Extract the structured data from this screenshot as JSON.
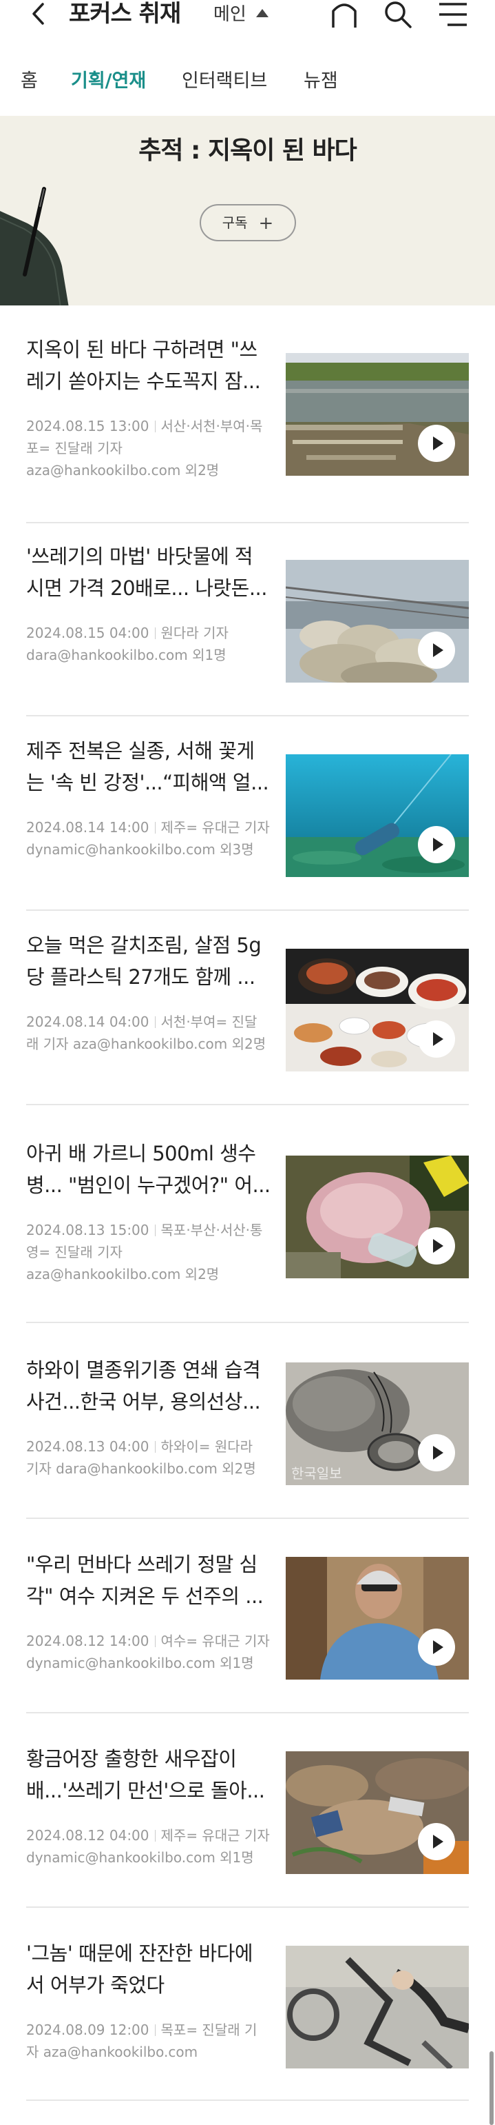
{
  "header": {
    "back_icon": "chevron-left-icon",
    "section_title": "포커스 취재",
    "sub_select": "메인",
    "icons": [
      "home-icon",
      "search-icon",
      "menu-icon"
    ]
  },
  "tabs": [
    {
      "label": "홈",
      "active": false
    },
    {
      "label": "기획/연재",
      "active": true
    },
    {
      "label": "인터랙티브",
      "active": false
    },
    {
      "label": "뉴잼",
      "active": false
    }
  ],
  "colors": {
    "accent": "#1a8f8a",
    "banner_bg": "#f2f0e7",
    "meta_text": "#999999"
  },
  "banner": {
    "title": "추적 : 지옥이 된 바다",
    "subscribe_label": "구독",
    "subscribe_icon": "+"
  },
  "articles": [
    {
      "title_lines": [
        "지옥이 된 바다 구하려면 \"쓰",
        "레기 쏟아지는 수도꼭지 잠..."
      ],
      "date": "2024.08.15 13:00",
      "byline_lines": [
        "서산·서천·부여·목",
        "포= 진달래 기자",
        "aza@hankookilbo.com 외2명"
      ],
      "thumb": "river-dock-photo",
      "play_icon": "play-icon"
    },
    {
      "title_lines": [
        "'쓰레기의 마법' 바닷물에 적",
        "시면 가격 20배로... 나랏돈..."
      ],
      "date": "2024.08.15 04:00",
      "byline_lines": [
        "원다라 기자",
        "dara@hankookilbo.com 외1명"
      ],
      "thumb": "trash-bags-pier-photo",
      "play_icon": "play-icon"
    },
    {
      "title_lines": [
        "제주 전복은 실종, 서해 꽃게",
        "는 '속 빈 강정'...“피해액 얼..."
      ],
      "date": "2024.08.14 14:00",
      "byline_lines": [
        "제주= 유대근 기자",
        "dynamic@hankookilbo.com 외3명"
      ],
      "thumb": "underwater-photo",
      "play_icon": "play-icon"
    },
    {
      "title_lines": [
        "오늘 먹은 갈치조림, 살점 5g",
        "당 플라스틱 27개도 함께 ..."
      ],
      "date": "2024.08.14 04:00",
      "byline_lines": [
        "서천·부여= 진달",
        "래 기자 aza@hankookilbo.com 외2명"
      ],
      "thumb": "korean-meal-photo",
      "play_icon": "play-icon"
    },
    {
      "title_lines": [
        "아귀 배 가르니 500ml 생수",
        "병... \"범인이 누구겠어?\" 어..."
      ],
      "date": "2024.08.13 15:00",
      "byline_lines": [
        "목포·부산·서산·통",
        "영= 진달래 기자",
        "aza@hankookilbo.com 외2명"
      ],
      "thumb": "fish-bottle-photo",
      "play_icon": "play-icon"
    },
    {
      "title_lines": [
        "하와이 멸종위기종 연쇄 습격",
        "사건...한국 어부, 용의선상..."
      ],
      "date": "2024.08.13 04:00",
      "byline_lines": [
        "하와이= 원다라",
        "기자 dara@hankookilbo.com 외2명"
      ],
      "thumb": "seal-net-photo",
      "thumb_watermark": "한국일보",
      "play_icon": "play-icon"
    },
    {
      "title_lines": [
        "\"우리 먼바다 쓰레기 정말 심",
        "각\" 여수 지켜온 두 선주의 ..."
      ],
      "date": "2024.08.12 14:00",
      "byline_lines": [
        "여수= 유대근 기자",
        "dynamic@hankookilbo.com 외1명"
      ],
      "thumb": "man-portrait-photo",
      "play_icon": "play-icon"
    },
    {
      "title_lines": [
        "황금어장 출항한 새우잡이",
        "배...'쓰레기 만선'으로 돌아..."
      ],
      "date": "2024.08.12 04:00",
      "byline_lines": [
        "제주= 유대근 기자",
        "dynamic@hankookilbo.com 외1명"
      ],
      "thumb": "shrimp-catch-photo",
      "play_icon": "play-icon"
    },
    {
      "title_lines": [
        "'그놈' 때문에 잔잔한 바다에",
        "서 어부가 죽었다"
      ],
      "date": "2024.08.09 12:00",
      "byline_lines": [
        "목포= 진달래 기",
        "자 aza@hankookilbo.com"
      ],
      "thumb": "illustration-photo",
      "play_icon": "none"
    }
  ]
}
